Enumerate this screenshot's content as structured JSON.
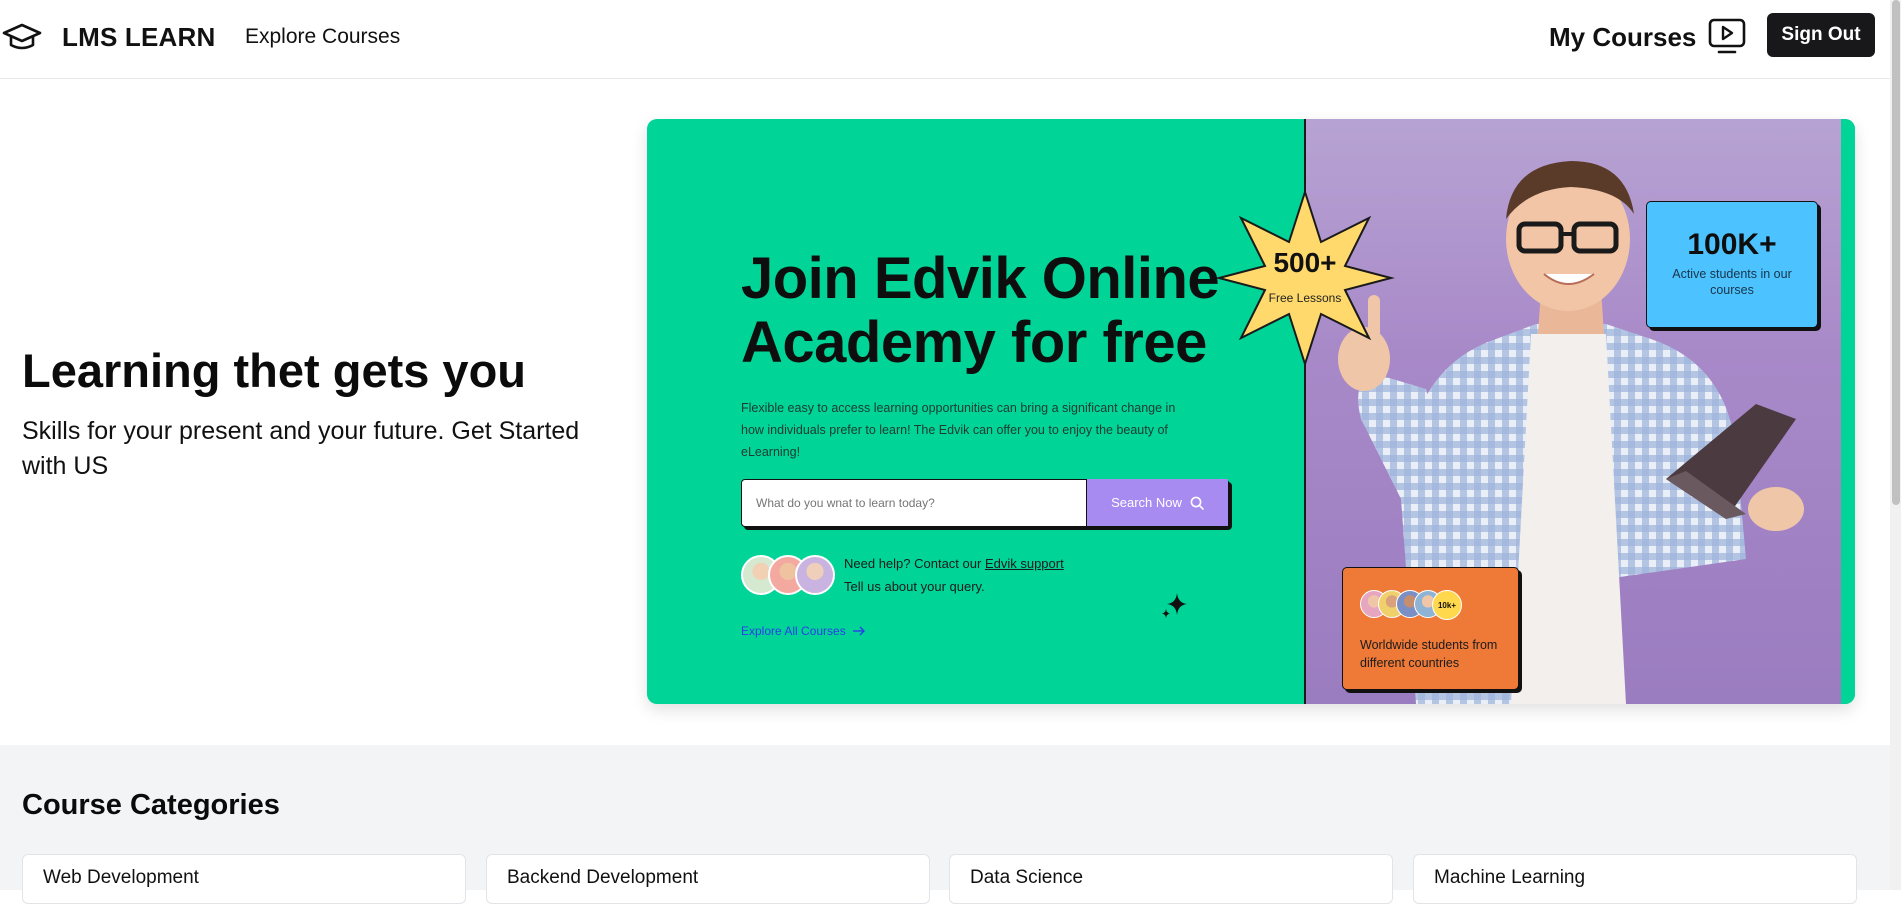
{
  "header": {
    "brand": "LMS LEARN",
    "nav_explore": "Explore Courses",
    "my_courses": "My Courses",
    "sign_out": "Sign Out"
  },
  "hero": {
    "title": "Learning thet gets you",
    "subtitle": "Skills for your present and your future. Get Started with US"
  },
  "banner": {
    "title": "Join Edvik Online Academy for free",
    "description": "Flexible easy to access learning opportunities can bring a significant change in how individuals prefer to learn! The Edvik can offer you to enjoy the beauty of eLearning!",
    "search_placeholder": "What do you wnat to learn today?",
    "search_button": "Search Now",
    "help_prefix": "Need help? Contact our ",
    "help_link": "Edvik support",
    "help_line2": "Tell us about your query.",
    "explore_all": "Explore All Courses",
    "star_number": "500+",
    "star_label": "Free Lessons",
    "stat_number": "100K+",
    "stat_label": "Active students in our courses",
    "badge_count": "10k+",
    "worldwide_label": "Worldwide students from different countries"
  },
  "categories": {
    "title": "Course Categories",
    "items": [
      "Web Development",
      "Backend Development",
      "Data Science",
      "Machine Learning"
    ]
  },
  "colors": {
    "banner_green": "#00d497",
    "banner_purple": "#a889c8",
    "stat_blue": "#4cc3ff",
    "worldwide_orange": "#ef7a38",
    "star_yellow": "#ffd96b",
    "search_button_purple": "#a78bf0",
    "signout_bg": "#18181b"
  }
}
